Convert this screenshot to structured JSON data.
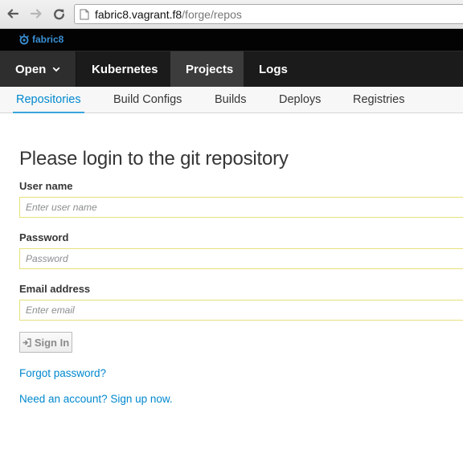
{
  "browser": {
    "url_host": "fabric8.vagrant.f8",
    "url_path": "/forge/repos",
    "icons": [
      "back-icon",
      "forward-icon",
      "reload-icon",
      "page-icon"
    ]
  },
  "brand": {
    "name": "fabric8",
    "color": "#3a8fd3"
  },
  "main_nav": {
    "open_label": "Open",
    "items": [
      "Kubernetes",
      "Projects",
      "Logs"
    ],
    "active": "Projects"
  },
  "sub_nav": {
    "items": [
      "Repositories",
      "Build Configs",
      "Builds",
      "Deploys",
      "Registries"
    ],
    "active": "Repositories"
  },
  "form": {
    "title": "Please login to the git repository",
    "username": {
      "label": "User name",
      "placeholder": "Enter user name"
    },
    "password": {
      "label": "Password",
      "placeholder": "Password"
    },
    "email": {
      "label": "Email address",
      "placeholder": "Enter email"
    },
    "sign_in_label": "Sign In",
    "forgot_link": "Forgot password?",
    "signup_link": "Need an account? Sign up now."
  },
  "colors": {
    "accent": "#0088ce",
    "field_border": "#e6e17c",
    "nav_bg": "#1b1b1b"
  }
}
